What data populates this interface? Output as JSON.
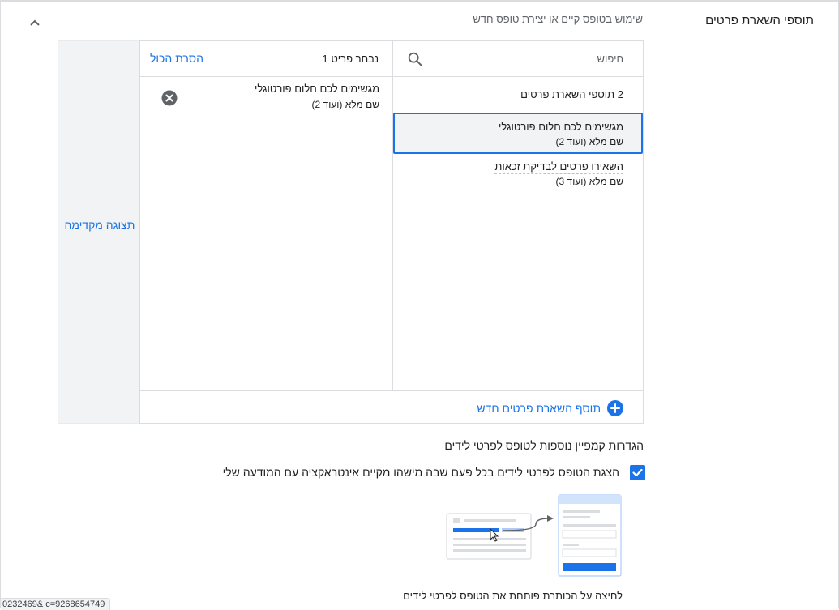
{
  "section": {
    "title": "תוספי השארת פרטים",
    "subtitle": "שימוש בטופס קיים או יצירת טופס חדש",
    "collapse_icon": "chevron-up-icon"
  },
  "preview": {
    "label": "תצוגה מקדימה"
  },
  "search": {
    "placeholder": "חיפוש",
    "icon": "search-icon"
  },
  "selection": {
    "count_label": "נבחר פריט 1",
    "remove_all_label": "הסרת הכול"
  },
  "available": {
    "group_header": "2 תוספי השארת פרטים",
    "items": [
      {
        "title": "מגשימים לכם חלום פורטוגלי",
        "subtitle": "שם מלא (ועוד 2)",
        "selected": true
      },
      {
        "title": "השאירו פרטים לבדיקת זכאות",
        "subtitle": "שם מלא (ועוד 3)",
        "selected": false
      }
    ]
  },
  "chosen": {
    "items": [
      {
        "title": "מגשימים לכם חלום פורטוגלי",
        "subtitle": "שם מלא (ועוד 2)",
        "remove_icon": "close-circle-icon"
      }
    ]
  },
  "add_new": {
    "label": "תוסף השארת פרטים חדש",
    "icon": "plus-circle-icon"
  },
  "settings": {
    "heading": "הגדרות קמפיין נוספות לטופס לפרטי לידים",
    "checkbox_label": "הצגת הטופס לפרטי לידים בכל פעם שבה מישהו מקיים אינטראקציה עם המודעה שלי",
    "checkbox_checked": true,
    "illustration_caption": "לחיצה על הכותרת פותחת את הטופס לפרטי לידים"
  },
  "status_bar": {
    "url_fragment": "0232469&  c=9268654749"
  },
  "colors": {
    "accent": "#1a73e8",
    "border": "#dadce0",
    "panel": "#f1f3f4",
    "text": "#202124",
    "muted": "#5f6368"
  }
}
